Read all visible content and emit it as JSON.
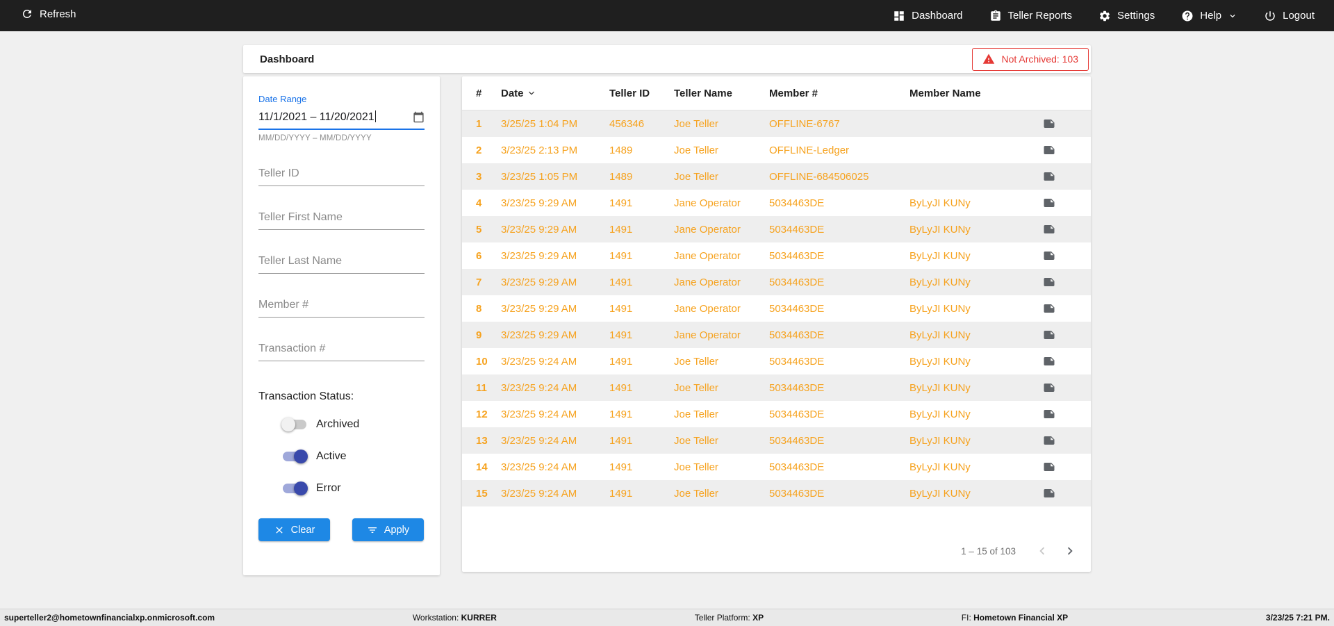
{
  "topbar": {
    "refresh_label": "Refresh",
    "nav": [
      {
        "label": "Dashboard"
      },
      {
        "label": "Teller Reports"
      },
      {
        "label": "Settings"
      },
      {
        "label": "Help"
      },
      {
        "label": "Logout"
      }
    ]
  },
  "header": {
    "title": "Dashboard",
    "badge_label": "Not Archived: 103"
  },
  "filters": {
    "date_range": {
      "label": "Date Range",
      "value": "11/1/2021 – 11/20/2021",
      "helper": "MM/DD/YYYY – MM/DD/YYYY"
    },
    "fields": [
      {
        "placeholder": "Teller ID"
      },
      {
        "placeholder": "Teller First Name"
      },
      {
        "placeholder": "Teller Last Name"
      },
      {
        "placeholder": "Member #"
      },
      {
        "placeholder": "Transaction #"
      }
    ],
    "status": {
      "label": "Transaction Status:",
      "toggles": [
        {
          "label": "Archived",
          "on": false
        },
        {
          "label": "Active",
          "on": true
        },
        {
          "label": "Error",
          "on": true
        }
      ]
    },
    "buttons": {
      "clear_label": "Clear",
      "apply_label": "Apply"
    }
  },
  "table": {
    "columns": [
      "#",
      "Date",
      "Teller ID",
      "Teller Name",
      "Member #",
      "Member Name"
    ],
    "sorted_by": "Date",
    "rows": [
      {
        "num": "1",
        "date": "3/25/25 1:04 PM",
        "teller_id": "456346",
        "teller_name": "Joe Teller",
        "member_num": "OFFLINE-6767",
        "member_name": ""
      },
      {
        "num": "2",
        "date": "3/23/25 2:13 PM",
        "teller_id": "1489",
        "teller_name": "Joe Teller",
        "member_num": "OFFLINE-Ledger",
        "member_name": ""
      },
      {
        "num": "3",
        "date": "3/23/25 1:05 PM",
        "teller_id": "1489",
        "teller_name": "Joe Teller",
        "member_num": "OFFLINE-684506025",
        "member_name": ""
      },
      {
        "num": "4",
        "date": "3/23/25 9:29 AM",
        "teller_id": "1491",
        "teller_name": "Jane Operator",
        "member_num": "5034463DE",
        "member_name": "ByLyJI KUNy"
      },
      {
        "num": "5",
        "date": "3/23/25 9:29 AM",
        "teller_id": "1491",
        "teller_name": "Jane Operator",
        "member_num": "5034463DE",
        "member_name": "ByLyJI KUNy"
      },
      {
        "num": "6",
        "date": "3/23/25 9:29 AM",
        "teller_id": "1491",
        "teller_name": "Jane Operator",
        "member_num": "5034463DE",
        "member_name": "ByLyJI KUNy"
      },
      {
        "num": "7",
        "date": "3/23/25 9:29 AM",
        "teller_id": "1491",
        "teller_name": "Jane Operator",
        "member_num": "5034463DE",
        "member_name": "ByLyJI KUNy"
      },
      {
        "num": "8",
        "date": "3/23/25 9:29 AM",
        "teller_id": "1491",
        "teller_name": "Jane Operator",
        "member_num": "5034463DE",
        "member_name": "ByLyJI KUNy"
      },
      {
        "num": "9",
        "date": "3/23/25 9:29 AM",
        "teller_id": "1491",
        "teller_name": "Jane Operator",
        "member_num": "5034463DE",
        "member_name": "ByLyJI KUNy"
      },
      {
        "num": "10",
        "date": "3/23/25 9:24 AM",
        "teller_id": "1491",
        "teller_name": "Joe Teller",
        "member_num": "5034463DE",
        "member_name": "ByLyJI KUNy"
      },
      {
        "num": "11",
        "date": "3/23/25 9:24 AM",
        "teller_id": "1491",
        "teller_name": "Joe Teller",
        "member_num": "5034463DE",
        "member_name": "ByLyJI KUNy"
      },
      {
        "num": "12",
        "date": "3/23/25 9:24 AM",
        "teller_id": "1491",
        "teller_name": "Joe Teller",
        "member_num": "5034463DE",
        "member_name": "ByLyJI KUNy"
      },
      {
        "num": "13",
        "date": "3/23/25 9:24 AM",
        "teller_id": "1491",
        "teller_name": "Joe Teller",
        "member_num": "5034463DE",
        "member_name": "ByLyJI KUNy"
      },
      {
        "num": "14",
        "date": "3/23/25 9:24 AM",
        "teller_id": "1491",
        "teller_name": "Joe Teller",
        "member_num": "5034463DE",
        "member_name": "ByLyJI KUNy"
      },
      {
        "num": "15",
        "date": "3/23/25 9:24 AM",
        "teller_id": "1491",
        "teller_name": "Joe Teller",
        "member_num": "5034463DE",
        "member_name": "ByLyJI KUNy"
      }
    ],
    "pagination": {
      "range_label": "1 – 15 of 103"
    }
  },
  "footer": {
    "user": "superteller2@hometownfinancialxp.onmicrosoft.com",
    "workstation_label": "Workstation:",
    "workstation_value": "KURRER",
    "platform_label": "Teller Platform:",
    "platform_value": "XP",
    "fi_label": "FI:",
    "fi_value": "Hometown Financial XP",
    "datetime": "3/23/25 7:21 PM."
  },
  "colors": {
    "accent_blue": "#1E88E5",
    "row_text_orange": "#F6A21E",
    "alert_red": "#E53935",
    "toggle_on_blue": "#3949AB",
    "topbar_bg": "#1F1F1F"
  }
}
